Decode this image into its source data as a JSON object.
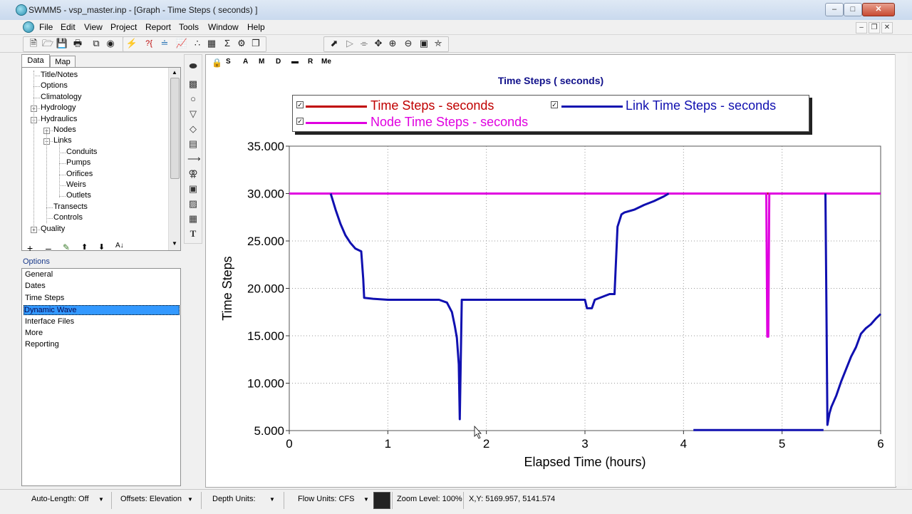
{
  "window": {
    "title": "SWMM5 - vsp_master.inp - [Graph -  Time Steps ( seconds) ]"
  },
  "menu": [
    "File",
    "Edit",
    "View",
    "Project",
    "Report",
    "Tools",
    "Window",
    "Help"
  ],
  "left_tabs": [
    "Data",
    "Map"
  ],
  "tree": [
    {
      "label": "Title/Notes",
      "level": 1
    },
    {
      "label": "Options",
      "level": 1
    },
    {
      "label": "Climatology",
      "level": 1
    },
    {
      "label": "Hydrology",
      "level": 1,
      "expander": "+"
    },
    {
      "label": "Hydraulics",
      "level": 1,
      "expander": "-"
    },
    {
      "label": "Nodes",
      "level": 2,
      "expander": "+"
    },
    {
      "label": "Links",
      "level": 2,
      "expander": "-"
    },
    {
      "label": "Conduits",
      "level": 3
    },
    {
      "label": "Pumps",
      "level": 3
    },
    {
      "label": "Orifices",
      "level": 3
    },
    {
      "label": "Weirs",
      "level": 3
    },
    {
      "label": "Outlets",
      "level": 3
    },
    {
      "label": "Transects",
      "level": 2
    },
    {
      "label": "Controls",
      "level": 2
    },
    {
      "label": "Quality",
      "level": 1,
      "expander": "+"
    }
  ],
  "options_header": "Options",
  "options_list": [
    "General",
    "Dates",
    "Time Steps",
    "Dynamic Wave",
    "Interface Files",
    "More",
    "Reporting"
  ],
  "options_selected": "Dynamic Wave",
  "graph_toolbar": [
    "S",
    "A",
    "M",
    "D",
    "R",
    "Me"
  ],
  "statusbar": {
    "auto_length": "Auto-Length: Off",
    "offsets": "Offsets: Elevation",
    "depth_units": "Depth Units:",
    "flow_units": "Flow Units: CFS",
    "zoom": "Zoom Level: 100%",
    "xy": "X,Y: 5169.957, 5141.574"
  },
  "colors": {
    "time_steps": "#c00000",
    "link_time_steps": "#1010b0",
    "node_time_steps": "#e000e0",
    "title": "#10108a"
  },
  "chart_data": {
    "type": "line",
    "title": "Time Steps ( seconds)",
    "xlabel": "Elapsed Time (hours)",
    "ylabel": "Time Steps",
    "xlim": [
      0,
      6
    ],
    "ylim": [
      5,
      35
    ],
    "xticks": [
      0,
      1,
      2,
      3,
      4,
      5,
      6
    ],
    "yticks": [
      5,
      10,
      15,
      20,
      25,
      30,
      35
    ],
    "ytick_labels": [
      "5.000",
      "10.000",
      "15.000",
      "20.000",
      "25.000",
      "30.000",
      "35.000"
    ],
    "grid": true,
    "legend_position": "top",
    "series": [
      {
        "name": "Time Steps - seconds",
        "color": "#c00000",
        "x": [
          0,
          6
        ],
        "y": [
          30,
          30
        ]
      },
      {
        "name": "Link Time Steps - seconds",
        "color": "#1010b0",
        "x": [
          0.42,
          0.47,
          0.52,
          0.57,
          0.62,
          0.67,
          0.73,
          0.75,
          0.76,
          0.85,
          1.0,
          1.5,
          1.52,
          1.6,
          1.65,
          1.68,
          1.7,
          1.72,
          1.73,
          1.75,
          2.0,
          2.5,
          3.0,
          3.02,
          3.07,
          3.1,
          3.2,
          3.25,
          3.3,
          3.33,
          3.37,
          3.4,
          3.5,
          3.6,
          3.7,
          3.8,
          3.85
        ],
        "y": [
          30,
          28.3,
          26.8,
          25.6,
          24.8,
          24.2,
          23.9,
          21.0,
          19.0,
          18.9,
          18.8,
          18.8,
          18.8,
          18.5,
          17.5,
          16.0,
          14.8,
          12.0,
          6.2,
          18.8,
          18.8,
          18.8,
          18.8,
          17.9,
          17.9,
          18.8,
          19.2,
          19.4,
          19.4,
          26.5,
          27.8,
          28.0,
          28.3,
          28.8,
          29.2,
          29.7,
          30.0
        ]
      },
      {
        "name": "Link Time Steps - seconds",
        "color": "#1010b0",
        "x": [
          4.1,
          4.5,
          5.0,
          5.3,
          5.42
        ],
        "y": [
          5.05,
          5.05,
          5.05,
          5.05,
          5.05
        ]
      },
      {
        "name": "Link Time Steps - seconds",
        "color": "#1010b0",
        "x": [
          5.44,
          5.45,
          5.46,
          5.48,
          5.5,
          5.55,
          5.6,
          5.65,
          5.7,
          5.75,
          5.8,
          5.85,
          5.9,
          5.95,
          6.0
        ],
        "y": [
          30,
          18,
          5.6,
          6.8,
          7.5,
          8.7,
          10.2,
          11.5,
          12.8,
          13.8,
          15.2,
          15.8,
          16.2,
          16.8,
          17.3
        ]
      },
      {
        "name": "Node Time Steps - seconds",
        "color": "#e000e0",
        "x": [
          0,
          4.84,
          4.85,
          4.86,
          4.87,
          6.0
        ],
        "y": [
          30,
          30,
          14.9,
          14.9,
          30,
          30
        ]
      }
    ]
  }
}
